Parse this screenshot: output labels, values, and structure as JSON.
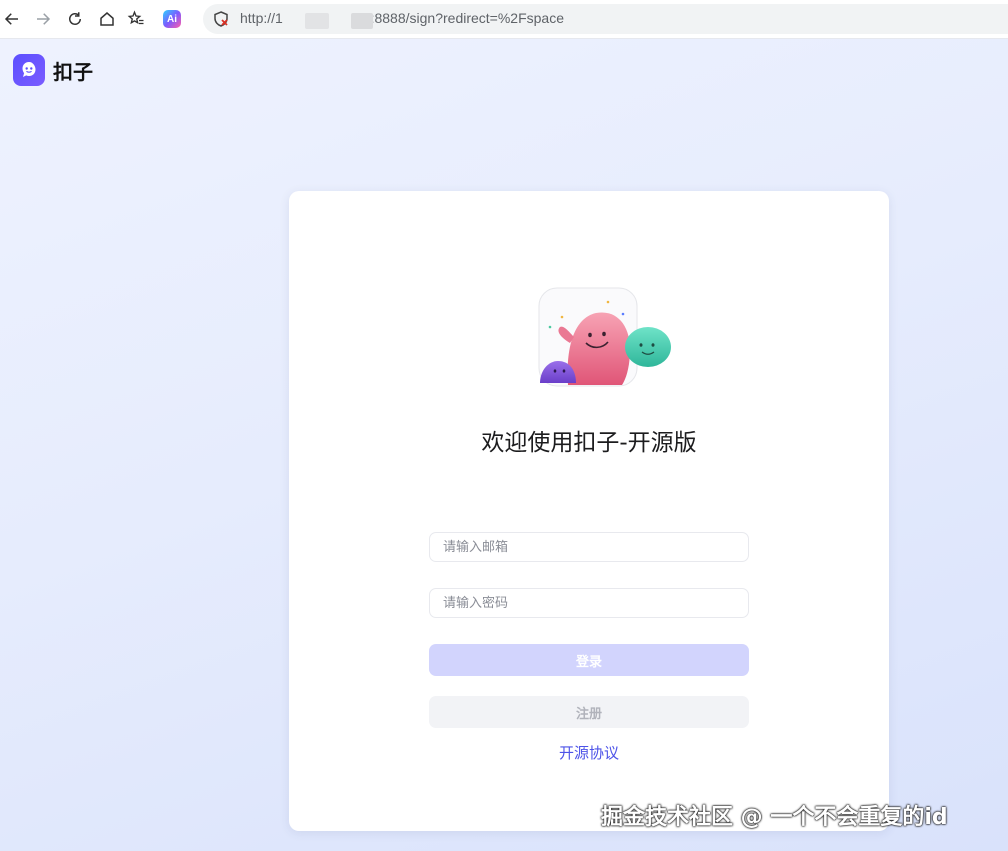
{
  "browser": {
    "url_prefix": "http://1",
    "url_suffix": "4:8888/sign?redirect=%2Fspace",
    "ai_label": "Ai"
  },
  "brand": {
    "name": "扣子"
  },
  "login_card": {
    "title": "欢迎使用扣子-开源版",
    "email_placeholder": "请输入邮箱",
    "password_placeholder": "请输入密码",
    "login_label": "登录",
    "register_label": "注册",
    "agreement_link": "开源协议"
  },
  "watermark": "掘金技术社区 @ 一个不会重复的id",
  "colors": {
    "accent": "#4d53e8",
    "login_button_disabled": "#d2d4fd",
    "register_button": "#f2f3f6"
  }
}
